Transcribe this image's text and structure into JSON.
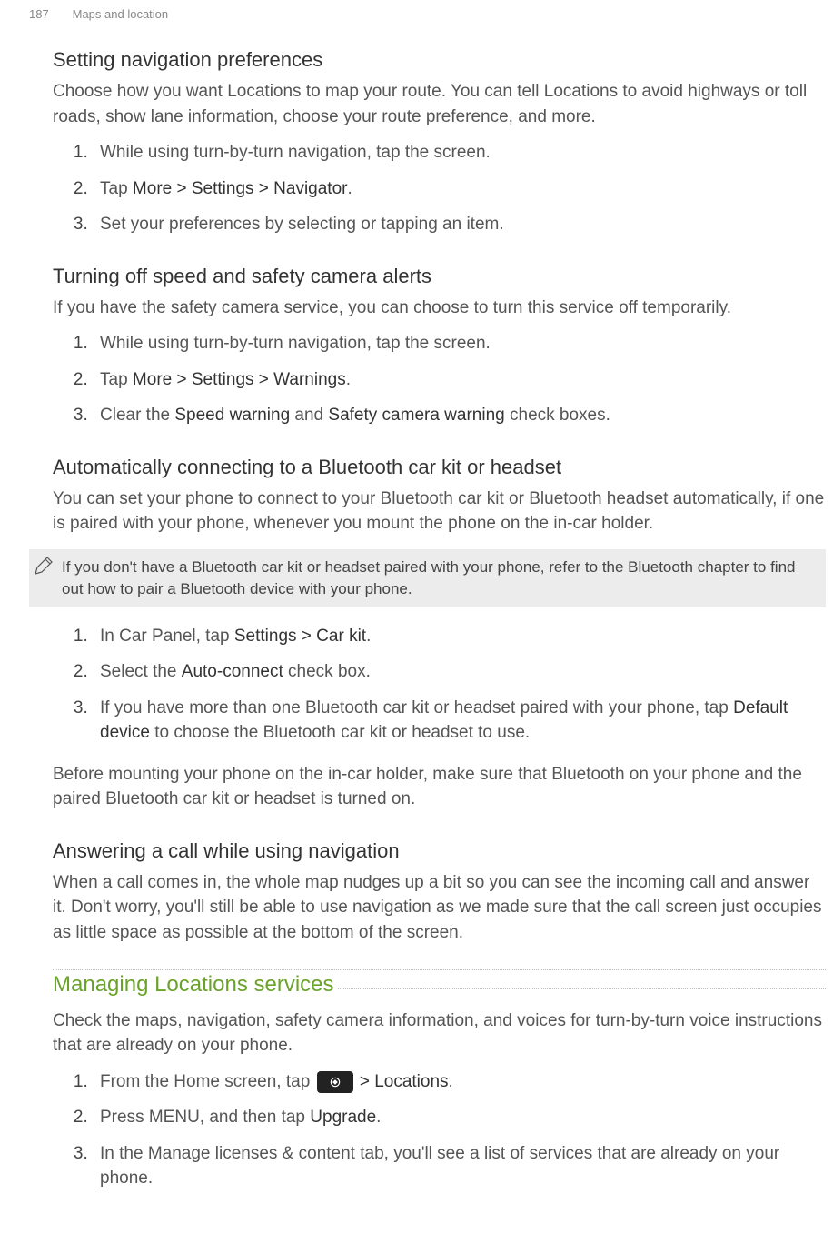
{
  "running_header": {
    "page_number": "187",
    "section": "Maps and location"
  },
  "s1": {
    "heading": "Setting navigation preferences",
    "intro": "Choose how you want Locations to map your route. You can tell Locations to avoid highways or toll roads, show lane information, choose your route preference, and more.",
    "steps": {
      "a": "While using turn-by-turn navigation, tap the screen.",
      "b_pre": "Tap ",
      "b_strong": "More > Settings > Navigator",
      "b_post": ".",
      "c": "Set your preferences by selecting or tapping an item."
    }
  },
  "s2": {
    "heading": "Turning off speed and safety camera alerts",
    "intro": "If you have the safety camera service, you can choose to turn this service off temporarily.",
    "steps": {
      "a": "While using turn-by-turn navigation, tap the screen.",
      "b_pre": "Tap ",
      "b_strong": "More > Settings > Warnings",
      "b_post": ".",
      "c_pre": "Clear the ",
      "c_s1": "Speed warning",
      "c_mid": " and ",
      "c_s2": "Safety camera warning",
      "c_post": " check boxes."
    }
  },
  "s3": {
    "heading": "Automatically connecting to a Bluetooth car kit or headset",
    "intro": "You can set your phone to connect to your Bluetooth car kit or Bluetooth headset automatically, if one is paired with your phone, whenever you mount the phone on the in-car holder.",
    "note": "If you don't have a Bluetooth car kit or headset paired with your phone, refer to the Bluetooth chapter to find out how to pair a Bluetooth device with your phone.",
    "steps": {
      "a_pre": "In Car Panel, tap ",
      "a_strong": "Settings > Car kit",
      "a_post": ".",
      "b_pre": "Select the ",
      "b_strong": "Auto-connect",
      "b_post": " check box.",
      "c_pre": "If you have more than one Bluetooth car kit or headset paired with your phone, tap ",
      "c_strong": "Default device",
      "c_post": " to choose the Bluetooth car kit or headset to use."
    },
    "outro": "Before mounting your phone on the in-car holder, make sure that Bluetooth on your phone and the paired Bluetooth car kit or headset is turned on."
  },
  "s4": {
    "heading": "Answering a call while using navigation",
    "intro": "When a call comes in, the whole map nudges up a bit so you can see the incoming call and answer it. Don't worry, you'll still be able to use navigation as we made sure that the call screen just occupies as little space as possible at the bottom of the screen."
  },
  "s5": {
    "heading": "Managing Locations services",
    "intro": "Check the maps, navigation, safety camera information, and voices for turn-by-turn voice instructions that are already on your phone.",
    "steps": {
      "a_pre": "From the Home screen, tap ",
      "a_strong": " > Locations",
      "a_post": ".",
      "b_pre": "Press MENU, and then tap ",
      "b_strong": "Upgrade",
      "b_post": ".",
      "c": "In the Manage licenses & content tab, you'll see a list of services that are already on your phone."
    }
  }
}
